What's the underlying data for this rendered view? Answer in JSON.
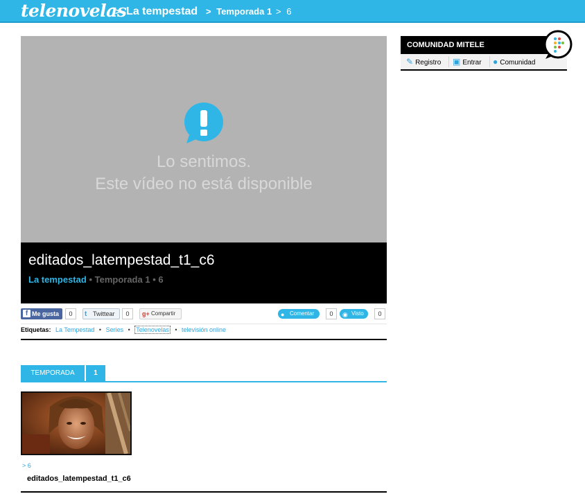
{
  "header": {
    "logo": "telenovelas",
    "breadcrumb": [
      {
        "sep": ">",
        "label": "La tempestad"
      },
      {
        "sep": ">",
        "label": "Temporada 1"
      },
      {
        "sep": ">",
        "label": "6"
      }
    ]
  },
  "player": {
    "message_line1": "Lo sentimos.",
    "message_line2": "Este vídeo no está disponible",
    "alert_icon": "exclamation-bubble-icon"
  },
  "video": {
    "title": "editados_latempestad_t1_c6",
    "show": "La tempestad",
    "separator": "•",
    "season": "Temporada 1",
    "episode": "6"
  },
  "social": {
    "facebook_label": "Me gusta",
    "facebook_count": "0",
    "twitter_label": "Twittear",
    "twitter_count": "0",
    "google_label": "Compartir",
    "comment_label": "Comentar",
    "comment_count": "0",
    "views_label": "Visto",
    "views_count": "0"
  },
  "tags": {
    "label": "Etiquetas:",
    "items": [
      "La Tempestad",
      "Series",
      "Telenovelas",
      "televisión online"
    ]
  },
  "season": {
    "tab_label": "TEMPORADA",
    "number": "1"
  },
  "episodes": [
    {
      "number_prefix": ">",
      "number": "6",
      "title": "editados_latempestad_t1_c6"
    }
  ],
  "community": {
    "title": "COMUNIDAD MITELE",
    "links": [
      {
        "icon": "pencil-icon",
        "label": "Registro"
      },
      {
        "icon": "lock-icon",
        "label": "Entrar"
      },
      {
        "icon": "speech-bubble-icon",
        "label": "Comunidad"
      }
    ]
  },
  "colors": {
    "accent": "#2fb6e6",
    "player_bg": "#b3b3b3",
    "dark": "#000000"
  }
}
